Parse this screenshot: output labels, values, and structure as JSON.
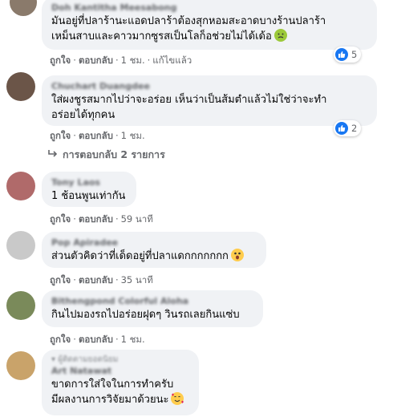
{
  "comments": [
    {
      "author": "Doh Kantitha Meesabong",
      "lines": [
        "มันอยู่ที่ปลาร้านะแอดปลาร้าต้องสุกหอมสะอาดบางร้านปลาร้า",
        "เหม็นสาบและคาวมากซูรสเป็นโลก็อช่วยไม่ได้เด้อ"
      ],
      "emoji": "nauseated-face",
      "like": "ถูกใจ",
      "reply": "ตอบกลับ",
      "time": "1 ชม.",
      "edited": "แก้ไขแล้ว",
      "reactions": "5"
    },
    {
      "author": "Chuchart Duangdee",
      "lines": [
        "ใส่ผงชูรสมากไปว่าจะอร่อย เห็นว่าเป็นส้มตำแล้วไม่ใช่ว่าจะทำ",
        "อร่อยได้ทุกคน"
      ],
      "like": "ถูกใจ",
      "reply": "ตอบกลับ",
      "time": "1 ชม.",
      "reactions": "2",
      "replies_link": "การตอบกลับ 2 รายการ"
    },
    {
      "author": "Tony Laos",
      "lines": [
        "1 ช้อนพูนเท่ากัน"
      ],
      "like": "ถูกใจ",
      "reply": "ตอบกลับ",
      "time": "59 นาที"
    },
    {
      "author": "Pop Apiradee",
      "lines": [
        "ส่วนตัวคิดว่าที่เด็ดอยู่ที่ปลาแดกกกกกกก"
      ],
      "emoji": "astonished-face",
      "like": "ถูกใจ",
      "reply": "ตอบกลับ",
      "time": "35 นาที"
    },
    {
      "author": "Bithengpond Colorful Aloha",
      "lines": [
        "กินไปมองรถไปอร่อยฝุดๆ วินรถเลยกินแซ่บ"
      ],
      "like": "ถูกใจ",
      "reply": "ตอบกลับ",
      "time": "1 ชม."
    },
    {
      "sub_author": "ผู้ติดตามยอดนิยม",
      "author": "Art Natawat",
      "lines": [
        "ขาดการใส่ใจในการทำครับ",
        "มีผลงานการวิจัยมาด้วยนะ"
      ],
      "emoji": "smiling-face-with-hearts"
    }
  ],
  "colors": {
    "bubble": "#f0f2f5",
    "meta": "#65676b",
    "like_blue": "#1877f2",
    "emoji_yellow": "#ffcc4d"
  }
}
